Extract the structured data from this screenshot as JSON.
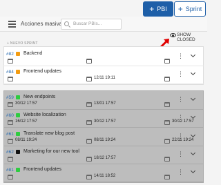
{
  "header": {
    "pbi_label": "PBI",
    "sprint_label": "Sprint"
  },
  "toolbar": {
    "bulk_actions_label": "Acciones masivas",
    "search_placeholder": "Buscar PBIs..."
  },
  "show_closed_label": "SHOW CLOSED",
  "new_sprint_label": "+ NUEVO SPRINT",
  "colors": {
    "primary": "#1e5fa8",
    "orange": "#f39c12",
    "green": "#2ecc40",
    "black": "#111111",
    "arrow_red": "#e00000"
  },
  "open_items": [
    {
      "id": "#82",
      "title": "Backend",
      "color": "orange",
      "start": "",
      "mid": "",
      "end": ""
    },
    {
      "id": "#84",
      "title": "Frontend updates",
      "color": "orange",
      "start": "",
      "mid": "12/11 19:11",
      "end": ""
    }
  ],
  "closed_items": [
    {
      "id": "#59",
      "title": "New endpoints",
      "color": "green",
      "start": "30/12 17:57",
      "mid": "13/01 17:57",
      "end": ""
    },
    {
      "id": "#60",
      "title": "Website localization",
      "color": "green",
      "start": "16/12 17:57",
      "mid": "30/12 17:57",
      "end": "30/12 17:57"
    },
    {
      "id": "#61",
      "title": "Translate new blog post",
      "color": "green",
      "start": "08/11 19:24",
      "mid": "08/11 19:24",
      "end": "22/11 19:24"
    },
    {
      "id": "#62",
      "title": "Marketing for our new tool",
      "color": "black",
      "start": "",
      "mid": "18/12 17:57",
      "end": ""
    },
    {
      "id": "#81",
      "title": "Frontend updates",
      "color": "green",
      "start": "",
      "mid": "14/11 18:52",
      "end": ""
    }
  ]
}
